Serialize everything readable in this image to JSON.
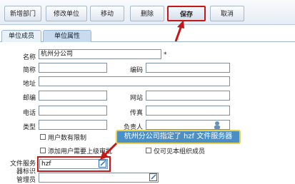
{
  "toolbar": {
    "buttons": [
      {
        "label": "新增部门"
      },
      {
        "label": "修改单位"
      },
      {
        "label": "移动"
      },
      {
        "label": "删除"
      },
      {
        "label": "保存"
      },
      {
        "label": "取消"
      }
    ]
  },
  "tabs": [
    {
      "label": "单位成员"
    },
    {
      "label": "单位属性"
    }
  ],
  "form": {
    "name": {
      "label": "名称",
      "value": "杭州分公司",
      "required_mark": "*"
    },
    "short_name": {
      "label": "简称",
      "value": ""
    },
    "code": {
      "label": "编码",
      "value": ""
    },
    "address": {
      "label": "地址",
      "value": ""
    },
    "zip": {
      "label": "邮编",
      "value": ""
    },
    "website": {
      "label": "网站",
      "value": ""
    },
    "phone": {
      "label": "电话",
      "value": ""
    },
    "fax": {
      "label": "传真",
      "value": ""
    },
    "type": {
      "label": "类型",
      "value": ""
    },
    "owner": {
      "label": "负责人",
      "value": ""
    },
    "checks": [
      {
        "label": "用户数有限制"
      },
      {
        "label": "添加用户需要上级审批"
      },
      {
        "label": "仅可见本组织成员"
      }
    ],
    "file_service": {
      "label_line1": "文件服务",
      "label_line2": "器标识",
      "value": "hzf"
    },
    "admin": {
      "label": "管理员",
      "value": ""
    }
  },
  "callout": {
    "text": "杭州分公司指定了 hzf 文件服务器"
  },
  "colors": {
    "accent": "#c61717",
    "callout_bg": "#4a8fc6",
    "callout_border": "#e9d14f"
  },
  "icons": [
    "edit-icon",
    "user-picker-icon",
    "red-arrow-icon"
  ]
}
